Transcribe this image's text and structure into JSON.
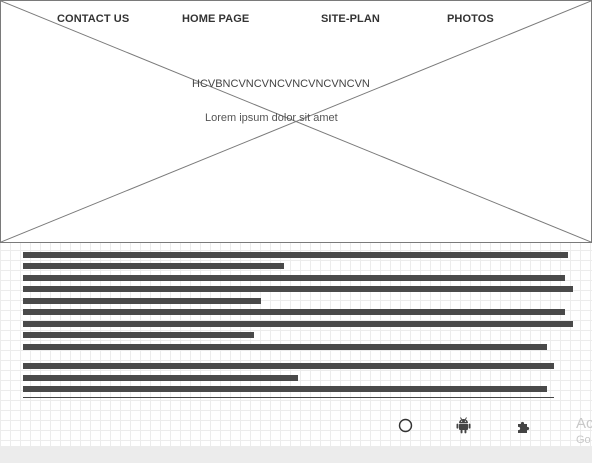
{
  "nav": {
    "links": [
      "CONTACT US",
      "HOME PAGE",
      "SITE-PLAN",
      "PHOTOS"
    ]
  },
  "hero": {
    "heading": "HCVBNCVNCVNCVNCVNCVNCVN",
    "subtext": "Lorem ipsum dolor sit amet"
  },
  "footer_icons": [
    "circle-icon",
    "android-icon",
    "puzzle-icon"
  ],
  "watermark": {
    "line1": "Ac",
    "line2": "Go"
  },
  "colors": {
    "text_line": "#4a4a4a",
    "border": "#7a7a7a",
    "grid": "#ececec"
  }
}
